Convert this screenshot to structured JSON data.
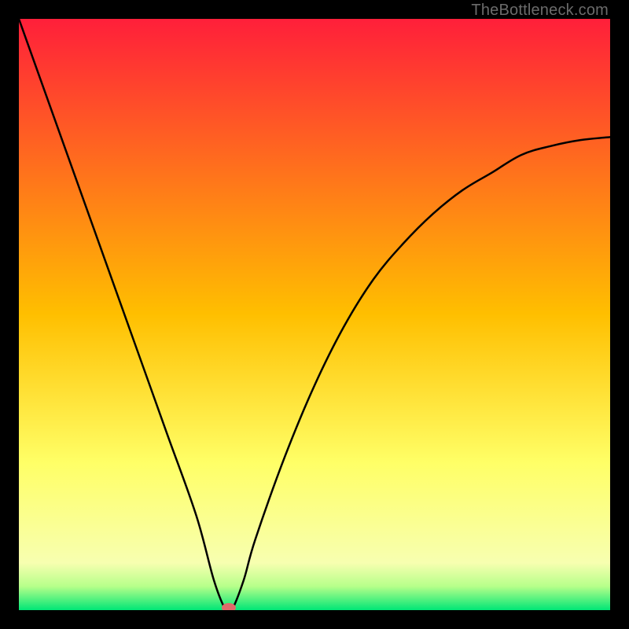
{
  "watermark": "TheBottleneck.com",
  "chart_data": {
    "type": "line",
    "title": "",
    "xlabel": "",
    "ylabel": "",
    "xlim": [
      0,
      100
    ],
    "ylim": [
      0,
      100
    ],
    "grid": false,
    "legend": false,
    "background_gradient": {
      "stops": [
        {
          "offset": 0.0,
          "color": "#ff1f3a"
        },
        {
          "offset": 0.5,
          "color": "#ffbf00"
        },
        {
          "offset": 0.75,
          "color": "#ffff66"
        },
        {
          "offset": 0.92,
          "color": "#f7ffb0"
        },
        {
          "offset": 0.96,
          "color": "#b6ff8a"
        },
        {
          "offset": 1.0,
          "color": "#00e676"
        }
      ]
    },
    "series": [
      {
        "name": "bottleneck-curve",
        "x": [
          0,
          5,
          10,
          15,
          20,
          25,
          30,
          33,
          35,
          36,
          38,
          40,
          45,
          50,
          55,
          60,
          65,
          70,
          75,
          80,
          85,
          90,
          95,
          100
        ],
        "y": [
          100,
          86,
          72,
          58,
          44,
          30,
          16,
          5,
          0,
          0,
          5,
          12,
          26,
          38,
          48,
          56,
          62,
          67,
          71,
          74,
          77,
          78.5,
          79.5,
          80
        ]
      }
    ],
    "marker": {
      "name": "optimal-point",
      "x": 35.5,
      "y": 0,
      "color": "#e06a6a",
      "rx": 9,
      "ry": 6
    }
  }
}
